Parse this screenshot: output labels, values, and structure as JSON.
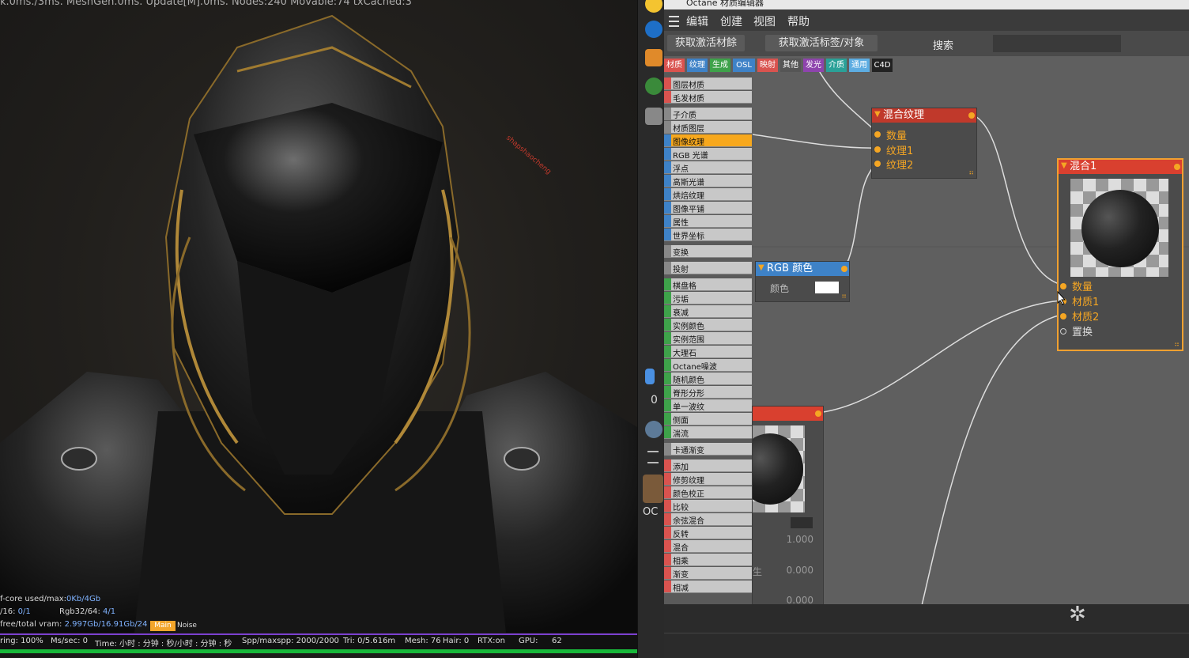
{
  "viewport": {
    "top_text": "k.0ms./3ms. MeshGen.0ms. Update[M].0ms. Nodes:240 Movable:74 txCached:3",
    "stats": {
      "core_label": "f-core used/max:",
      "core_value": "0Kb/4Gb",
      "buf_label": "/16:",
      "buf_value": "0/1",
      "rgb_label": "Rgb32/64:",
      "rgb_value": "4/1",
      "vram_label": "free/total vram:",
      "vram_value": "2.997Gb/16.91Gb/24",
      "tag_main": "Main",
      "tag_noise": "Noise"
    },
    "statusbar": {
      "rendering": "ring: 100%",
      "ms": "Ms/sec: 0",
      "time": "Time: 小时 : 分钟 : 秒/小时 : 分钟 : 秒",
      "spp": "Spp/maxspp: 2000/2000",
      "tri": "Tri: 0/5.616m",
      "mesh": "Mesh: 76",
      "hair": "Hair: 0",
      "rtx": "RTX:on",
      "gpu": "GPU:",
      "gpu_temp": "62"
    },
    "watermark": "shapshaocheng"
  },
  "strip": {
    "zero_label": "0",
    "oc_label": "OC"
  },
  "editor": {
    "title": "Octane 材质编辑器",
    "menu": [
      "编辑",
      "创建",
      "视图",
      "帮助"
    ],
    "toolbar": {
      "get_material": "获取激活材餘",
      "get_tag": "获取激活标签/对象",
      "search_label": "搜索",
      "search_value": ""
    },
    "category_tabs": [
      {
        "label": "材质",
        "color": "#d9534f"
      },
      {
        "label": "纹理",
        "color": "#3e82c7"
      },
      {
        "label": "生成",
        "color": "#3ea24a"
      },
      {
        "label": "OSL",
        "color": "#3e82c7"
      },
      {
        "label": "映射",
        "color": "#d9534f"
      },
      {
        "label": "其他",
        "color": "#555555"
      },
      {
        "label": "发光",
        "color": "#8e44ad"
      },
      {
        "label": "介质",
        "color": "#2aa198"
      },
      {
        "label": "通用",
        "color": "#5dade2"
      },
      {
        "label": "C4D",
        "color": "#222222"
      }
    ],
    "list_items": [
      {
        "label": "图层材质",
        "color": "#d9534f"
      },
      {
        "label": "毛发材质",
        "color": "#d9534f"
      },
      {
        "label": "子介质",
        "color": "#888888"
      },
      {
        "label": "材质图层",
        "color": "#888888"
      },
      {
        "label": "图像纹理",
        "color": "#3e82c7",
        "selected": true
      },
      {
        "label": "RGB 光谱",
        "color": "#3e82c7"
      },
      {
        "label": "浮点",
        "color": "#3e82c7"
      },
      {
        "label": "高斯光谱",
        "color": "#3e82c7"
      },
      {
        "label": "烘焙纹理",
        "color": "#3e82c7"
      },
      {
        "label": "图像平铺",
        "color": "#3e82c7"
      },
      {
        "label": "属性",
        "color": "#3e82c7"
      },
      {
        "label": "世界坐标",
        "color": "#3e82c7"
      },
      {
        "label": "变换",
        "color": "#888888"
      },
      {
        "label": "投射",
        "color": "#888888"
      },
      {
        "label": "棋盘格",
        "color": "#3ea24a"
      },
      {
        "label": "污垢",
        "color": "#3ea24a"
      },
      {
        "label": "衰减",
        "color": "#3ea24a"
      },
      {
        "label": "实例颜色",
        "color": "#3ea24a"
      },
      {
        "label": "实例范围",
        "color": "#3ea24a"
      },
      {
        "label": "大理石",
        "color": "#3ea24a"
      },
      {
        "label": "Octane噪波",
        "color": "#3ea24a"
      },
      {
        "label": "随机颜色",
        "color": "#3ea24a"
      },
      {
        "label": "脊形分形",
        "color": "#3ea24a"
      },
      {
        "label": "单一波纹",
        "color": "#3ea24a"
      },
      {
        "label": "侧面",
        "color": "#3ea24a"
      },
      {
        "label": "湍流",
        "color": "#3ea24a"
      },
      {
        "label": "卡通渐变",
        "color": "#888888"
      },
      {
        "label": "添加",
        "color": "#d9534f"
      },
      {
        "label": "修剪纹理",
        "color": "#d9534f"
      },
      {
        "label": "颜色校正",
        "color": "#d9534f"
      },
      {
        "label": "比较",
        "color": "#d9534f"
      },
      {
        "label": "余弦混合",
        "color": "#d9534f"
      },
      {
        "label": "反转",
        "color": "#d9534f"
      },
      {
        "label": "混合",
        "color": "#d9534f"
      },
      {
        "label": "相乘",
        "color": "#d9534f"
      },
      {
        "label": "渐变",
        "color": "#d9534f"
      },
      {
        "label": "相减",
        "color": "#d9534f"
      }
    ],
    "nodes": {
      "mix_texture": {
        "title": "混合纹理",
        "ports": [
          "数量",
          "纹理1",
          "纹理2"
        ]
      },
      "rgb_color": {
        "title": "RGB 颜色",
        "param_label": "颜色",
        "color": "#ffffff"
      },
      "mix1": {
        "title": "混合1",
        "ports": [
          "数量",
          "材质1",
          "材质2",
          "置换"
        ]
      },
      "partial": {
        "values": [
          "1.000",
          "0.000",
          "0.000"
        ],
        "clipped_label": "生"
      }
    }
  }
}
